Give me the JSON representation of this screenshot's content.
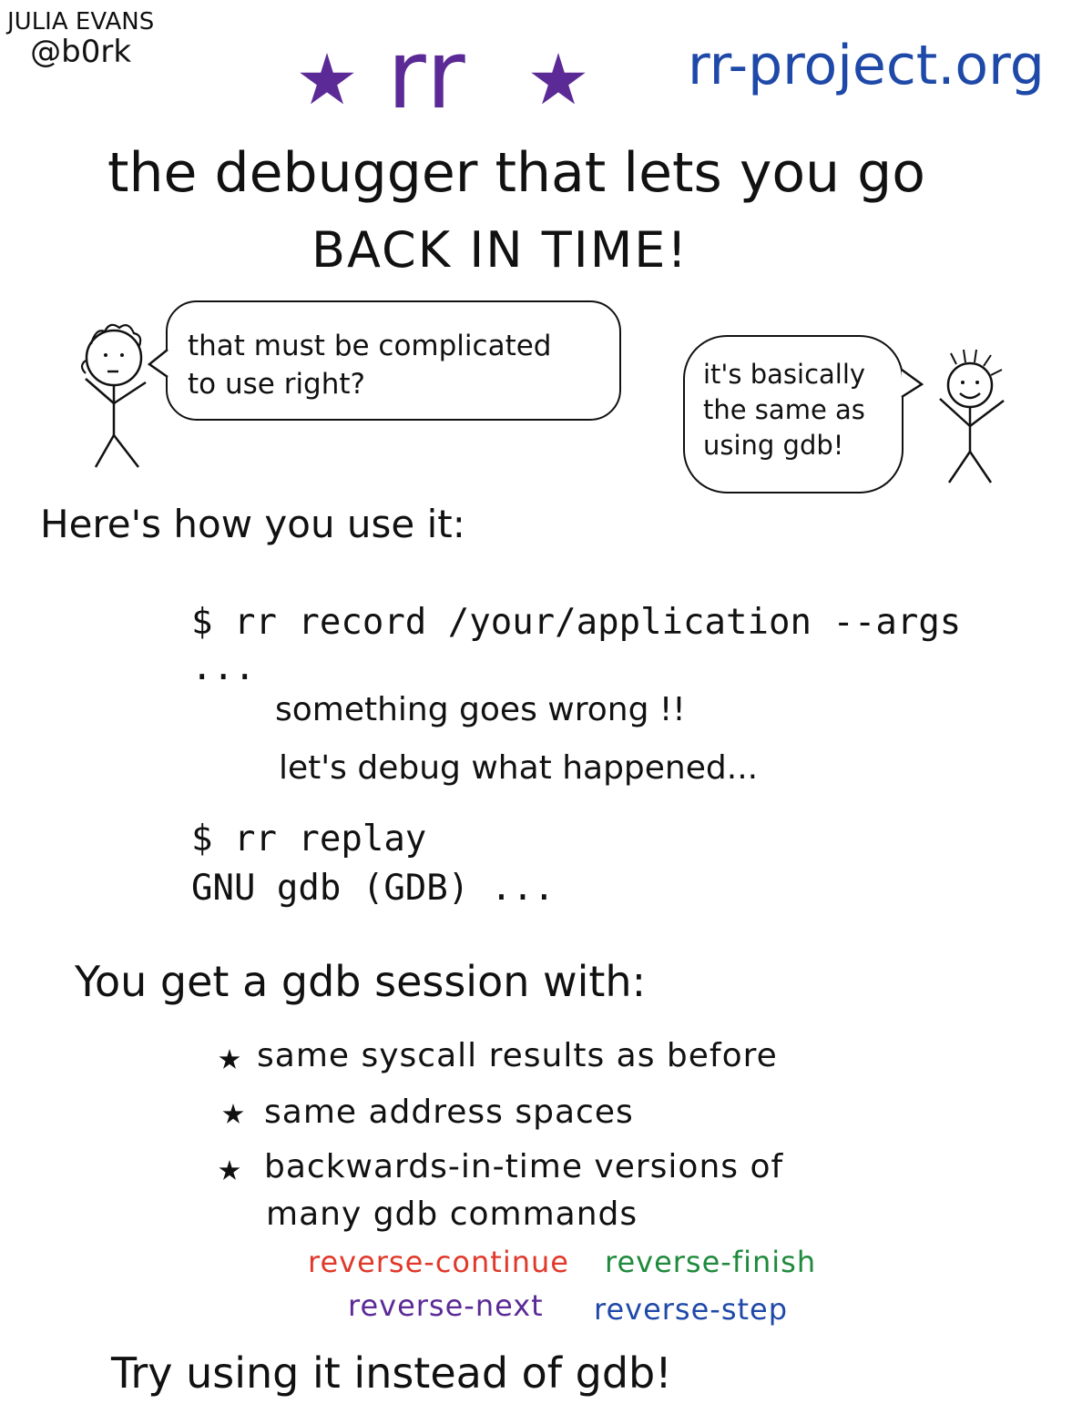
{
  "author": {
    "name": "JULIA EVANS",
    "handle": "@b0rk"
  },
  "header": {
    "title": "rr",
    "url": "rr-project.org",
    "tagline_line1": "the debugger that lets you go",
    "tagline_line2": "BACK IN TIME!"
  },
  "dialogue": {
    "left_bubble": [
      "that must be complicated",
      "to use right?"
    ],
    "right_bubble": [
      "it's basically",
      "the same as",
      "using gdb!"
    ]
  },
  "usage": {
    "heading": "Here's how you use it:",
    "record_command": "$ rr record /your/application --args",
    "ellipsis": "...",
    "note1": "something goes wrong !!",
    "note2": "let's debug what happened...",
    "replay_command": "$ rr replay",
    "gdb_output": "GNU gdb (GDB) ..."
  },
  "session": {
    "heading": "You get a gdb session with:",
    "bullets": [
      "same syscall results as before",
      "same address spaces",
      "backwards-in-time versions of",
      "many gdb commands"
    ],
    "commands": [
      {
        "label": "reverse-continue",
        "color": "#e0392b"
      },
      {
        "label": "reverse-finish",
        "color": "#1f8a3c"
      },
      {
        "label": "reverse-next",
        "color": "#5b2a96"
      },
      {
        "label": "reverse-step",
        "color": "#1f49a8"
      }
    ]
  },
  "footer": {
    "call_to_action": "Try using it instead of gdb!"
  },
  "colors": {
    "title_purple": "#5b2a96",
    "url_blue": "#1f49a8",
    "ink": "#111111"
  }
}
